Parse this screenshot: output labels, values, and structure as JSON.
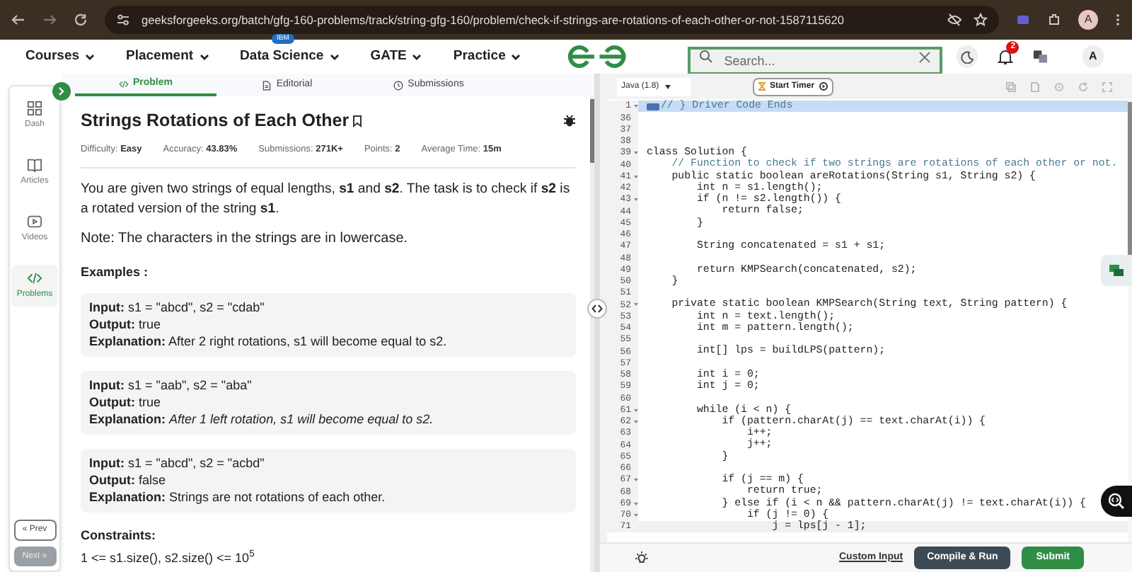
{
  "browser": {
    "url": "geeksforgeeks.org/batch/gfg-160-problems/track/string-gfg-160/problem/check-if-strings-are-rotations-of-each-other-or-not-1587115620",
    "profile": "A"
  },
  "nav": {
    "menus": [
      {
        "label": "Courses"
      },
      {
        "label": "Placement"
      },
      {
        "label": "Data Science",
        "badge": "IBM"
      },
      {
        "label": "GATE"
      },
      {
        "label": "Practice"
      }
    ],
    "search": {
      "placeholder": "Search..."
    },
    "notifications": "2",
    "avatar": "A"
  },
  "sidebar": {
    "items": [
      {
        "label": "Dash",
        "selected": false
      },
      {
        "label": "Articles",
        "selected": false
      },
      {
        "label": "Videos",
        "selected": false
      },
      {
        "label": "Problems",
        "selected": true
      }
    ],
    "prev": "« Prev",
    "next": "Next »",
    "next_disabled": true
  },
  "tabs": [
    {
      "label": "Problem",
      "selected": true
    },
    {
      "label": "Editorial",
      "selected": false
    },
    {
      "label": "Submissions",
      "selected": false
    }
  ],
  "problem": {
    "title": "Strings Rotations of Each Other",
    "meta": [
      {
        "label": "Difficulty:",
        "value": "Easy"
      },
      {
        "label": "Accuracy:",
        "value": "43.83%"
      },
      {
        "label": "Submissions:",
        "value": "271K+"
      },
      {
        "label": "Points:",
        "value": "2"
      },
      {
        "label": "Average Time:",
        "value": "15m"
      }
    ],
    "description": "You are given two strings of equal lengths, **s1** and **s2**. The task is to check if **s2** is a rotated version of the string **s1**.",
    "note": "Note: The characters in the strings are in lowercase.",
    "examples_heading": "Examples :",
    "examples": [
      {
        "lines": [
          "**Input:** s1 = \"abcd\", s2 = \"cdab\"",
          "**Output:** true",
          "**Explanation:** After 2 right rotations, s1 will become equal to s2."
        ]
      },
      {
        "lines": [
          "**Input:** s1 = \"aab\", s2 = \"aba\"",
          "**Output:** true",
          "**Explanation:** *After 1 left rotation, s1 will become equal to s2.*"
        ]
      },
      {
        "lines": [
          "**Input:** s1 = \"abcd\", s2 = \"acbd\"",
          "**Output:** false",
          "**Explanation:** Strings are not rotations of each other."
        ]
      }
    ],
    "constraints_heading": "Constraints:",
    "constraints": "1 <= s1.size(), s2.size() <= 10$^{5}$"
  },
  "editor": {
    "language": "Java (1.8)",
    "timer": "Start Timer",
    "lines": [
      {
        "num": "1",
        "text": "// } Driver Code Ends",
        "fold": true,
        "highlighted": true,
        "kind": "comment"
      },
      {
        "num": "36",
        "fold": false,
        "highlighted": false,
        "kind": "code"
      },
      {
        "num": "37",
        "fold": false,
        "highlighted": false,
        "kind": "code"
      },
      {
        "num": "38",
        "fold": false,
        "highlighted": false,
        "kind": "code"
      },
      {
        "num": "39",
        "text": "class Solution {",
        "fold": true,
        "highlighted": false,
        "kind": "code"
      },
      {
        "num": "40",
        "text": "    // Function to check if two strings are rotations of each other or not.",
        "fold": false,
        "highlighted": false,
        "kind": "comment"
      },
      {
        "num": "41",
        "text": "    public static boolean areRotations(String s1, String s2) {",
        "fold": true,
        "highlighted": false,
        "kind": "code"
      },
      {
        "num": "42",
        "text": "        int n = s1.length();",
        "fold": false,
        "highlighted": false,
        "kind": "code"
      },
      {
        "num": "43",
        "text": "        if (n != s2.length()) {",
        "fold": true,
        "highlighted": false,
        "kind": "code"
      },
      {
        "num": "44",
        "text": "            return false;",
        "fold": false,
        "highlighted": false,
        "kind": "code"
      },
      {
        "num": "45",
        "text": "        }",
        "fold": false,
        "highlighted": false,
        "kind": "code"
      },
      {
        "num": "46",
        "fold": false,
        "highlighted": false,
        "kind": "code"
      },
      {
        "num": "47",
        "text": "        String concatenated = s1 + s1;",
        "fold": false,
        "highlighted": false,
        "kind": "code"
      },
      {
        "num": "48",
        "fold": false,
        "highlighted": false,
        "kind": "code"
      },
      {
        "num": "49",
        "text": "        return KMPSearch(concatenated, s2);",
        "fold": false,
        "highlighted": false,
        "kind": "code"
      },
      {
        "num": "50",
        "text": "    }",
        "fold": false,
        "highlighted": false,
        "kind": "code"
      },
      {
        "num": "51",
        "fold": false,
        "highlighted": false,
        "kind": "code"
      },
      {
        "num": "52",
        "text": "    private static boolean KMPSearch(String text, String pattern) {",
        "fold": true,
        "highlighted": false,
        "kind": "code"
      },
      {
        "num": "53",
        "text": "        int n = text.length();",
        "fold": false,
        "highlighted": false,
        "kind": "code"
      },
      {
        "num": "54",
        "text": "        int m = pattern.length();",
        "fold": false,
        "highlighted": false,
        "kind": "code"
      },
      {
        "num": "55",
        "fold": false,
        "highlighted": false,
        "kind": "code"
      },
      {
        "num": "56",
        "text": "        int[] lps = buildLPS(pattern);",
        "fold": false,
        "highlighted": false,
        "kind": "code"
      },
      {
        "num": "57",
        "fold": false,
        "highlighted": false,
        "kind": "code"
      },
      {
        "num": "58",
        "text": "        int i = 0;",
        "fold": false,
        "highlighted": false,
        "kind": "code"
      },
      {
        "num": "59",
        "text": "        int j = 0;",
        "fold": false,
        "highlighted": false,
        "kind": "code"
      },
      {
        "num": "60",
        "fold": false,
        "highlighted": false,
        "kind": "code"
      },
      {
        "num": "61",
        "text": "        while (i < n) {",
        "fold": true,
        "highlighted": false,
        "kind": "code"
      },
      {
        "num": "62",
        "text": "            if (pattern.charAt(j) == text.charAt(i)) {",
        "fold": true,
        "highlighted": false,
        "kind": "code"
      },
      {
        "num": "63",
        "text": "                i++;",
        "fold": false,
        "highlighted": false,
        "kind": "code"
      },
      {
        "num": "64",
        "text": "                j++;",
        "fold": false,
        "highlighted": false,
        "kind": "code"
      },
      {
        "num": "65",
        "text": "            }",
        "fold": false,
        "highlighted": false,
        "kind": "code"
      },
      {
        "num": "66",
        "fold": false,
        "highlighted": false,
        "kind": "code"
      },
      {
        "num": "67",
        "text": "            if (j == m) {",
        "fold": true,
        "highlighted": false,
        "kind": "code"
      },
      {
        "num": "68",
        "text": "                return true;",
        "fold": false,
        "highlighted": false,
        "kind": "code"
      },
      {
        "num": "69",
        "text": "            } else if (i < n && pattern.charAt(j) != text.charAt(i)) {",
        "fold": true,
        "highlighted": false,
        "kind": "code"
      },
      {
        "num": "70",
        "text": "                if (j != 0) {",
        "fold": true,
        "highlighted": false,
        "kind": "code"
      },
      {
        "num": "71",
        "text": "                    j = lps[j - 1];",
        "fold": false,
        "highlighted": false,
        "kind": "active"
      }
    ],
    "custom_input": "Custom Input",
    "compile": "Compile & Run",
    "submit": "Submit"
  }
}
